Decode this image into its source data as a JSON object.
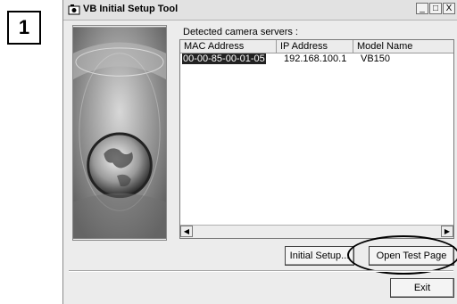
{
  "step": {
    "number": "1"
  },
  "window": {
    "title": "VB Initial Setup Tool",
    "controls": {
      "minimize": "_",
      "maximize": "□",
      "close": "X"
    }
  },
  "main": {
    "detected_label": "Detected camera servers :",
    "table": {
      "columns": [
        "MAC Address",
        "IP Address",
        "Model Name"
      ],
      "rows": [
        {
          "mac": "00-00-85-00-01-05",
          "ip": "192.168.100.1",
          "model": "VB150"
        }
      ]
    }
  },
  "buttons": {
    "initial_setup": "Initial Setup...",
    "open_test_page": "Open Test Page",
    "exit": "Exit"
  },
  "icons": [
    "app-camera-icon",
    "scroll-left-icon",
    "scroll-right-icon",
    "globe-image"
  ]
}
